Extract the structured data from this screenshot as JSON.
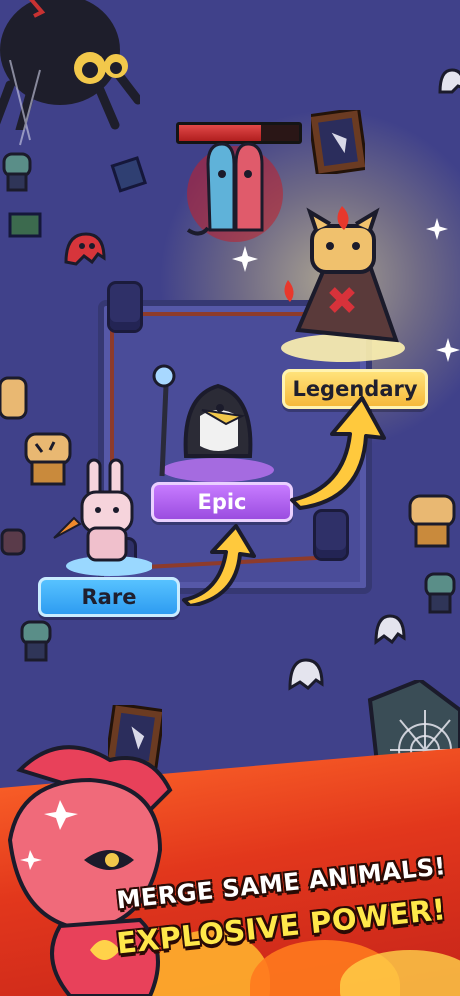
{
  "scene": {
    "boss_health_fraction": 0.68,
    "colors": {
      "floor": "#40418a",
      "rare": "#2e9cf1",
      "epic": "#9b4de0",
      "legendary": "#f6b93b",
      "banner": "#e2371c",
      "slogan_highlight": "#ffe84a"
    }
  },
  "tiers": {
    "rare": "Rare",
    "epic": "Epic",
    "legendary": "Legendary"
  },
  "banner": {
    "line1": "MERGE SAME ANIMALS!",
    "line2": "EXPLOSIVE POWER!"
  },
  "icons": [
    "spider-icon",
    "portrait-frame-icon",
    "book-icon",
    "ghost-icon",
    "zombie-icon",
    "tiger-icon",
    "cobweb-icon",
    "dragon-mascot-icon",
    "sparkle-icon",
    "rope-post-icon"
  ]
}
